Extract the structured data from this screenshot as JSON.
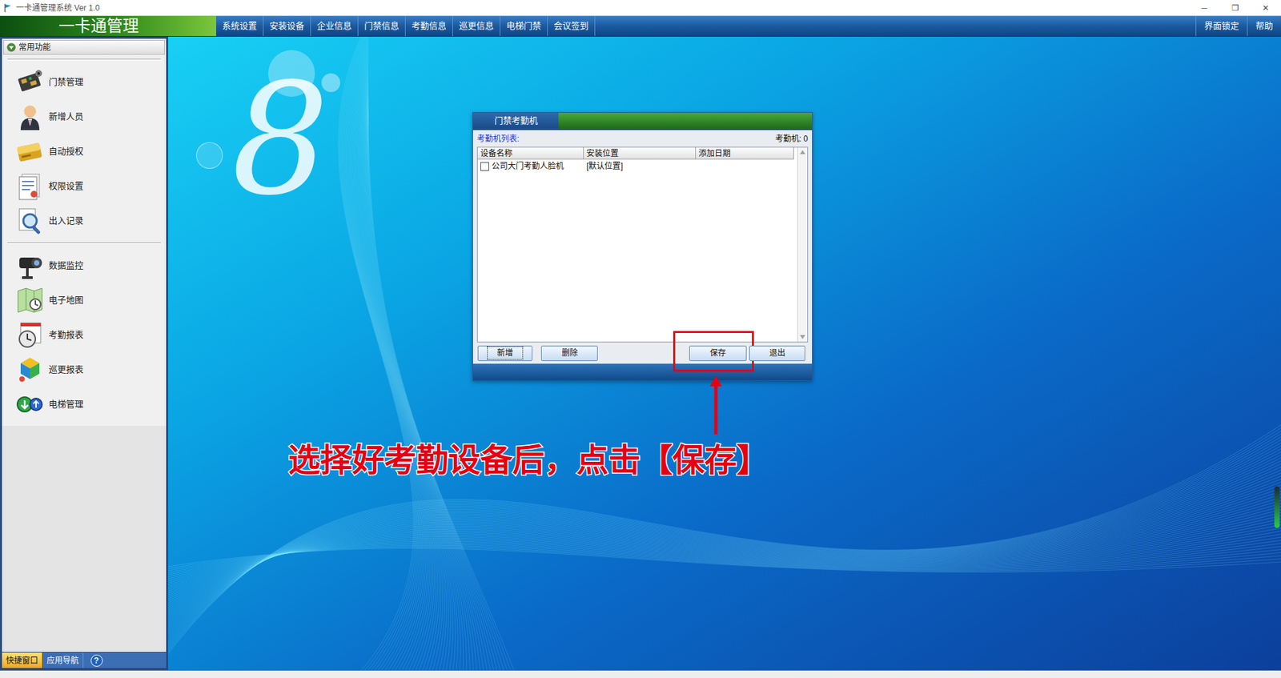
{
  "window": {
    "title": "一卡通管理系统 Ver 1.0",
    "controls": [
      "─",
      "❐",
      "✕"
    ]
  },
  "app_logo": "一卡通管理",
  "menu": [
    "系统设置",
    "安装设备",
    "企业信息",
    "门禁信息",
    "考勤信息",
    "巡更信息",
    "电梯门禁",
    "会议签到"
  ],
  "menu_right": [
    "界面锁定",
    "帮助"
  ],
  "sidebar": {
    "title": "常用功能",
    "expanded": true,
    "groups": [
      [
        {
          "label": "门禁管理"
        },
        {
          "label": "新增人员"
        },
        {
          "label": "自动授权"
        },
        {
          "label": "权限设置"
        },
        {
          "label": "出入记录"
        }
      ],
      [
        {
          "label": "数据监控"
        },
        {
          "label": "电子地图"
        },
        {
          "label": "考勤报表"
        },
        {
          "label": "巡更报表"
        },
        {
          "label": "电梯管理"
        }
      ]
    ],
    "tabs": [
      {
        "label": "快捷窗口",
        "selected": true
      },
      {
        "label": "应用导航",
        "selected": false
      },
      {
        "label": "?",
        "selected": false
      }
    ]
  },
  "desktop": {
    "logo_glyph": "8"
  },
  "dialog": {
    "tab": "门禁考勤机",
    "list_label": "考勤机列表:",
    "count": "考勤机: 0",
    "columns": [
      "设备名称",
      "安装位置",
      "添加日期"
    ],
    "rows": [
      {
        "checked": false,
        "cells": [
          "公司大门考勤人脸机",
          "[默认位置]",
          ""
        ]
      }
    ],
    "buttons": [
      {
        "label": "新增",
        "focused": true,
        "highlighted": false
      },
      {
        "label": "删除",
        "focused": false,
        "highlighted": false
      },
      {
        "label": "保存",
        "focused": false,
        "highlighted": true
      },
      {
        "label": "退出",
        "focused": false,
        "highlighted": false
      }
    ]
  },
  "annotation": {
    "text": "选择好考勤设备后，点击【保存】"
  }
}
